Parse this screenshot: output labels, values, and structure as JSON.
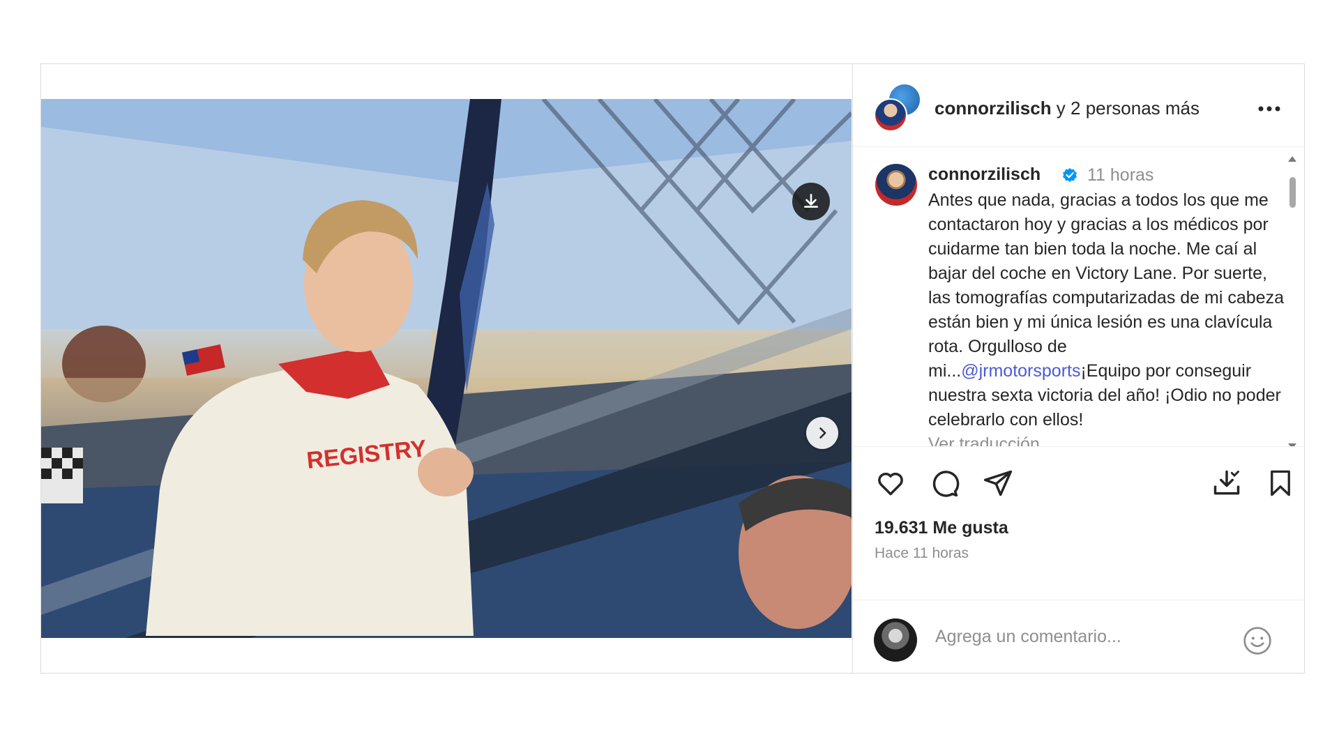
{
  "post": {
    "header": {
      "username": "connorzilisch",
      "co_authors": " y 2 personas más",
      "more_icon": "more-horizontal-icon"
    },
    "caption": {
      "username": "connorzilisch",
      "verified": true,
      "time": "11 horas",
      "text_before_mention": "Antes que nada, gracias a todos los que me contactaron hoy y gracias a los médicos por cuidarme tan bien toda la noche. Me caí al bajar del coche en Victory Lane. Por suerte, las tomografías computarizadas de mi cabeza están bien y mi única lesión es una clavícula rota. Orgulloso de mi...",
      "mention": "@jrmotorsports",
      "text_after_mention": "¡Equipo por conseguir nuestra sexta victoria del año! ¡Odio no poder celebrarlo con ellos!",
      "text_cut_line": "Ver traducción"
    },
    "media": {
      "carousel_count": 2,
      "carousel_active": 1,
      "suit_text": "REGISTRY",
      "icons": [
        "download-icon",
        "chevron-right-icon",
        "user-tag-icon"
      ]
    },
    "actions": {
      "likes": "19.631 Me gusta",
      "timestamp": "Hace 11 horas"
    },
    "comment": {
      "placeholder": "Agrega un comentario..."
    },
    "colors": {
      "mention": "#4a5ad8",
      "verified": "#0095f6",
      "muted": "#8e8e8e"
    }
  }
}
